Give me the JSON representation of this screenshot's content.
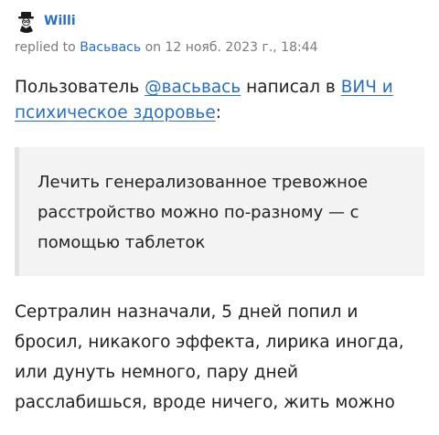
{
  "post": {
    "author": "Willi",
    "avatar_icon": "avatar-icon",
    "reply_prefix": "replied to",
    "reply_target": "Васьвась",
    "date_text": "on 12 нояб. 2023 г., 18:44"
  },
  "intro": {
    "prefix": "Пользователь ",
    "mention": "@васьвась",
    "middle": " написал в ",
    "topic_link": "ВИЧ и психическое здоровье",
    "suffix": ":"
  },
  "quote": {
    "text": "Лечить генерализованное тревожное расстройство можно по-разному — с помощью таблеток"
  },
  "reply": {
    "text": "Сертралин назначали, 5 дней попил и бросил, никакого эффекта, лирика иногда, или дунуть немного, пару дней расслабишься, вроде ничего, жить можно"
  },
  "colors": {
    "link": "#2a6fbd",
    "meta_text": "#7a7a7a",
    "quote_bg": "#f3f3f3",
    "quote_border": "#e2e2e2"
  }
}
